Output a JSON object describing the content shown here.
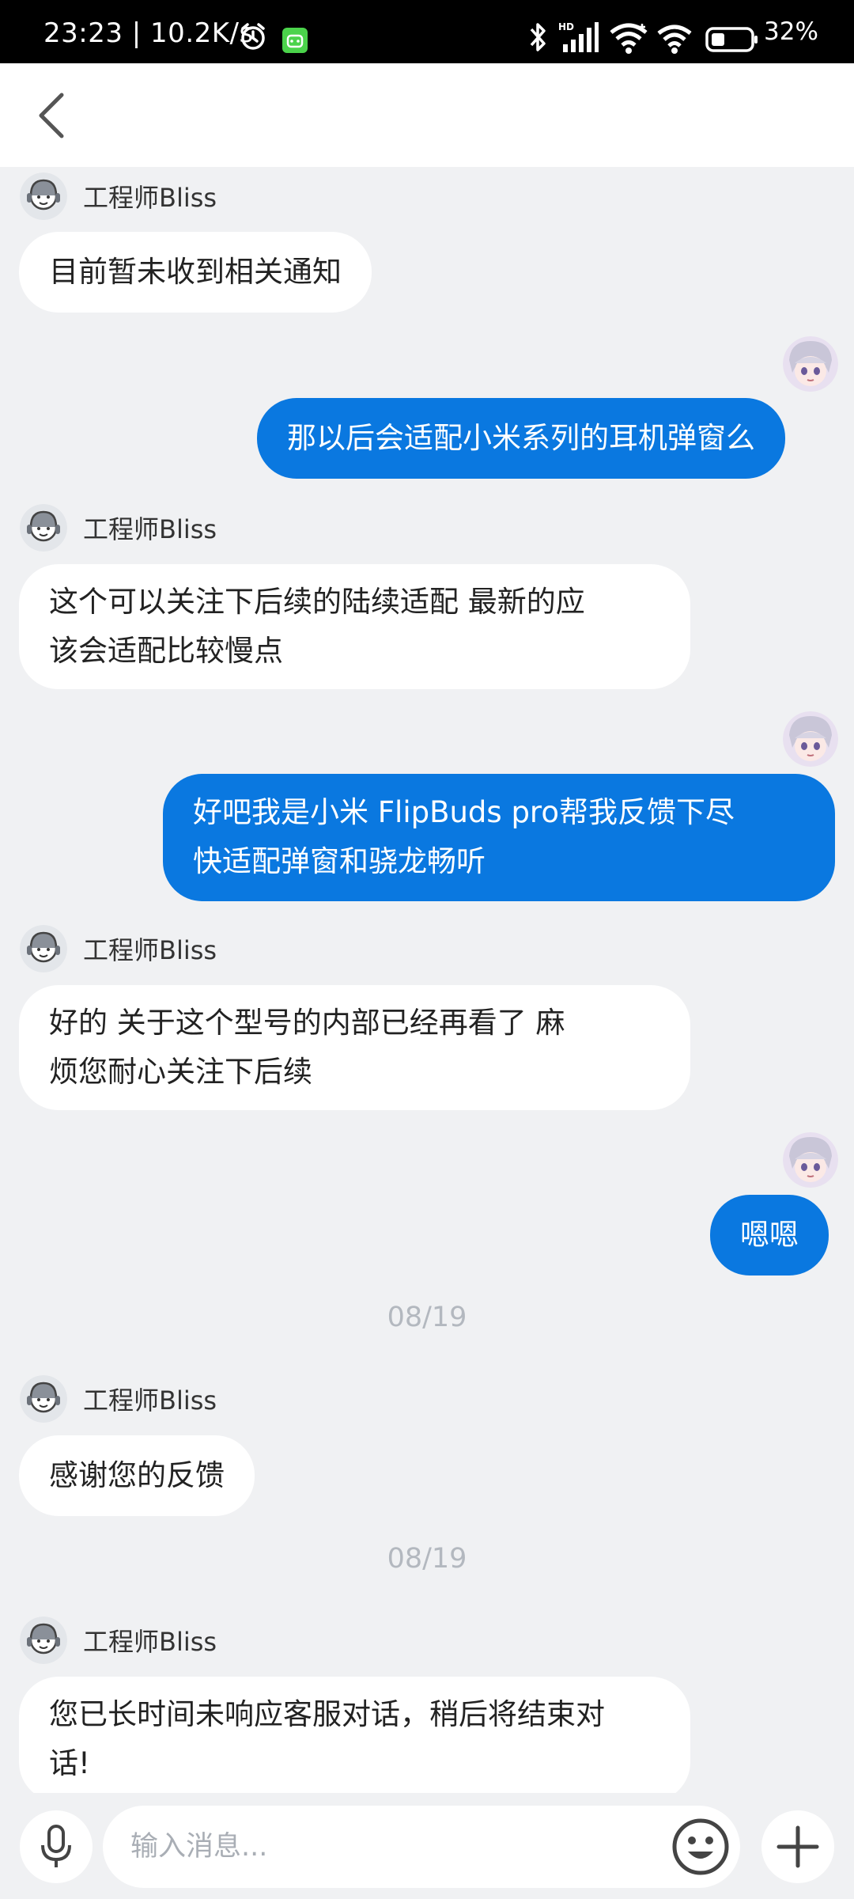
{
  "status_bar": {
    "time": "23:23 | 10.2K/s",
    "battery_percent": "32%",
    "icons": [
      "alarm-icon",
      "android-icon",
      "bluetooth-icon",
      "hd-signal-icon",
      "wifi-icon",
      "wifi-icon",
      "battery-icon"
    ]
  },
  "header": {
    "back_icon": "chevron-left-icon"
  },
  "chat": {
    "agent_name": "工程师Bliss",
    "messages": [
      {
        "sender": "agent",
        "name": "工程师Bliss",
        "lines": [
          "目前暂未收到相关通知"
        ]
      },
      {
        "sender": "user",
        "lines": [
          "那以后会适配小米系列的耳机弹窗么"
        ]
      },
      {
        "sender": "agent",
        "name": "工程师Bliss",
        "lines": [
          "这个可以关注下后续的陆续适配  最新的应",
          "该会适配比较慢点"
        ]
      },
      {
        "sender": "user",
        "lines": [
          "好吧我是小米 FlipBuds pro帮我反馈下尽",
          "快适配弹窗和骁龙畅听"
        ]
      },
      {
        "sender": "agent",
        "name": "工程师Bliss",
        "lines": [
          "好的  关于这个型号的内部已经再看了  麻",
          "烦您耐心关注下后续"
        ]
      },
      {
        "sender": "user",
        "lines": [
          "嗯嗯"
        ]
      },
      {
        "sender": "date",
        "text": "08/19"
      },
      {
        "sender": "agent",
        "name": "工程师Bliss",
        "lines": [
          "感谢您的反馈"
        ]
      },
      {
        "sender": "date",
        "text": "08/19"
      },
      {
        "sender": "agent",
        "name": "工程师Bliss",
        "lines": [
          "您已长时间未响应客服对话，稍后将结束对",
          "话!"
        ]
      }
    ]
  },
  "input_bar": {
    "placeholder": "输入消息...",
    "value": "",
    "icons": [
      "microphone-icon",
      "emoji-icon",
      "plus-icon"
    ]
  },
  "colors": {
    "user_bubble": "#0a78e0",
    "agent_bubble": "#ffffff",
    "background": "#f0f1f3",
    "date_text": "#b3b8bf"
  }
}
